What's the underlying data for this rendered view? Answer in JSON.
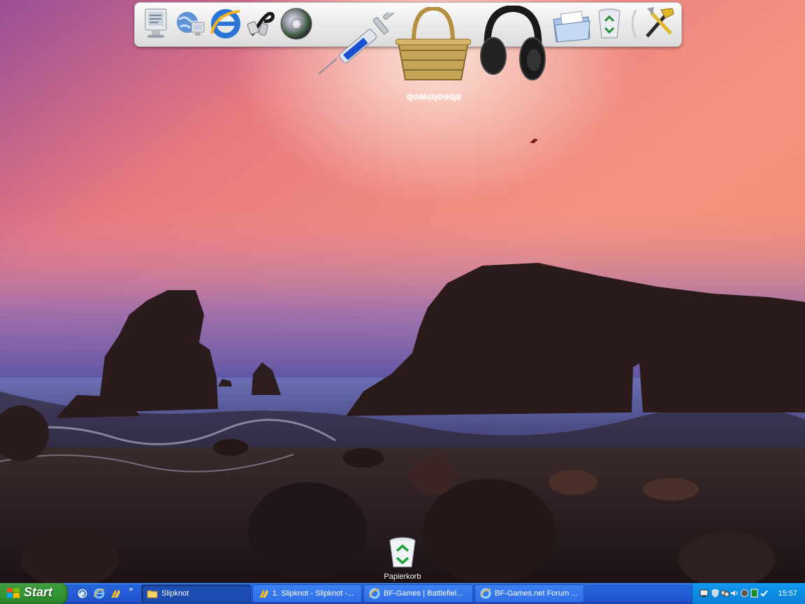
{
  "dock": {
    "items": [
      {
        "name": "my-computer-icon"
      },
      {
        "name": "network-icon"
      },
      {
        "name": "internet-explorer-icon"
      },
      {
        "name": "cable-plug-icon"
      },
      {
        "name": "cd-disc-icon"
      },
      {
        "name": "syringe-icon"
      },
      {
        "name": "basket-icon"
      },
      {
        "name": "headphones-icon"
      },
      {
        "name": "documents-folder-icon"
      },
      {
        "name": "recycle-bin-icon"
      },
      {
        "name": "separator-icon"
      },
      {
        "name": "tools-icon"
      }
    ],
    "hover_label": "downloads"
  },
  "desktop": {
    "icons": [
      {
        "label": "Papierkorb",
        "icon": "recycle-bin-icon"
      }
    ]
  },
  "taskbar": {
    "start_label": "Start",
    "quick_launch": [
      "show-desktop-icon",
      "internet-explorer-icon",
      "winamp-icon"
    ],
    "chevron": "»",
    "tasks": [
      {
        "label": "Slipknot",
        "icon": "folder-icon",
        "active": true
      },
      {
        "label": "1. Slipknot - Slipknot -...",
        "icon": "winamp-icon",
        "active": false
      },
      {
        "label": "BF-Games | Battlefiel...",
        "icon": "internet-explorer-icon",
        "active": false
      },
      {
        "label": "BF-Games.net Forum ...",
        "icon": "internet-explorer-icon",
        "active": false
      }
    ],
    "clock": "15:57"
  },
  "colors": {
    "taskbar_blue": "#245cd8",
    "start_green": "#329532",
    "tray_blue": "#0c8fe6"
  }
}
